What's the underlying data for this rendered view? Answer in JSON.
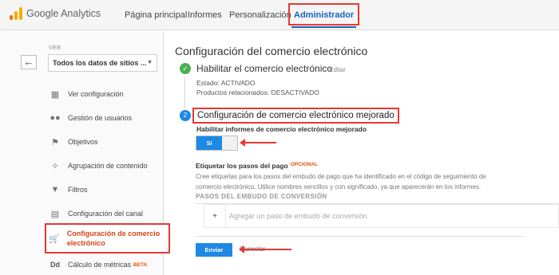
{
  "app": {
    "title": "Google Analytics"
  },
  "nav": {
    "tabs": [
      "Página principal",
      "Informes",
      "Personalización",
      "Administrador"
    ],
    "active": "Administrador",
    "accent": "#1565c0"
  },
  "sidebar": {
    "view_label": "VER",
    "account": "Todos los datos de sitios ...",
    "back_icon": "back-arrow-icon",
    "items": [
      {
        "label": "Ver configuración",
        "icon": "document-icon"
      },
      {
        "label": "Gestión de usuarios",
        "icon": "users-icon"
      },
      {
        "label": "Objetivos",
        "icon": "flag-icon"
      },
      {
        "label": "Agrupación de contenido",
        "icon": "person-icon"
      },
      {
        "label": "Filtros",
        "icon": "filter-icon"
      },
      {
        "label": "Configuración del canal",
        "icon": "channel-icon"
      },
      {
        "label": "Configuración de comercio electrónico",
        "icon": "cart-icon",
        "active": true
      },
      {
        "label": "Cálculo de métricas",
        "icon": "dd-icon",
        "badge": "BETA"
      }
    ]
  },
  "main": {
    "title": "Configuración del comercio electrónico",
    "step1": {
      "title": "Habilitar el comercio electrónico",
      "edit": "Editar",
      "status": "Estado: ACTIVADO",
      "related": "Productos relacionados: DESACTIVADO"
    },
    "step2": {
      "number": "2",
      "title": "Configuración de comercio electrónico mejorado",
      "enable_label": "Habilitar informes de comercio electrónico mejorado",
      "toggle_value": "Sí"
    },
    "checkout": {
      "label": "Etiquetar los pasos del pago",
      "optional": "OPCIONAL",
      "description": "Cree etiquetas para los pasos del embudo de pago que ha identificado en el código de seguimiento de comercio electrónico. Utilice nombres sencillos y con significado, ya que aparecerán en los informes.",
      "funnel_header": "PASOS DEL EMBUDO DE CONVERSIÓN",
      "add_step": "Agregar un paso de embudo de conversión"
    },
    "buttons": {
      "submit": "Enviar",
      "cancel": "Cancelar"
    }
  },
  "colors": {
    "highlight": "#e53935",
    "primary": "#1e88e5",
    "success": "#4caf50"
  }
}
